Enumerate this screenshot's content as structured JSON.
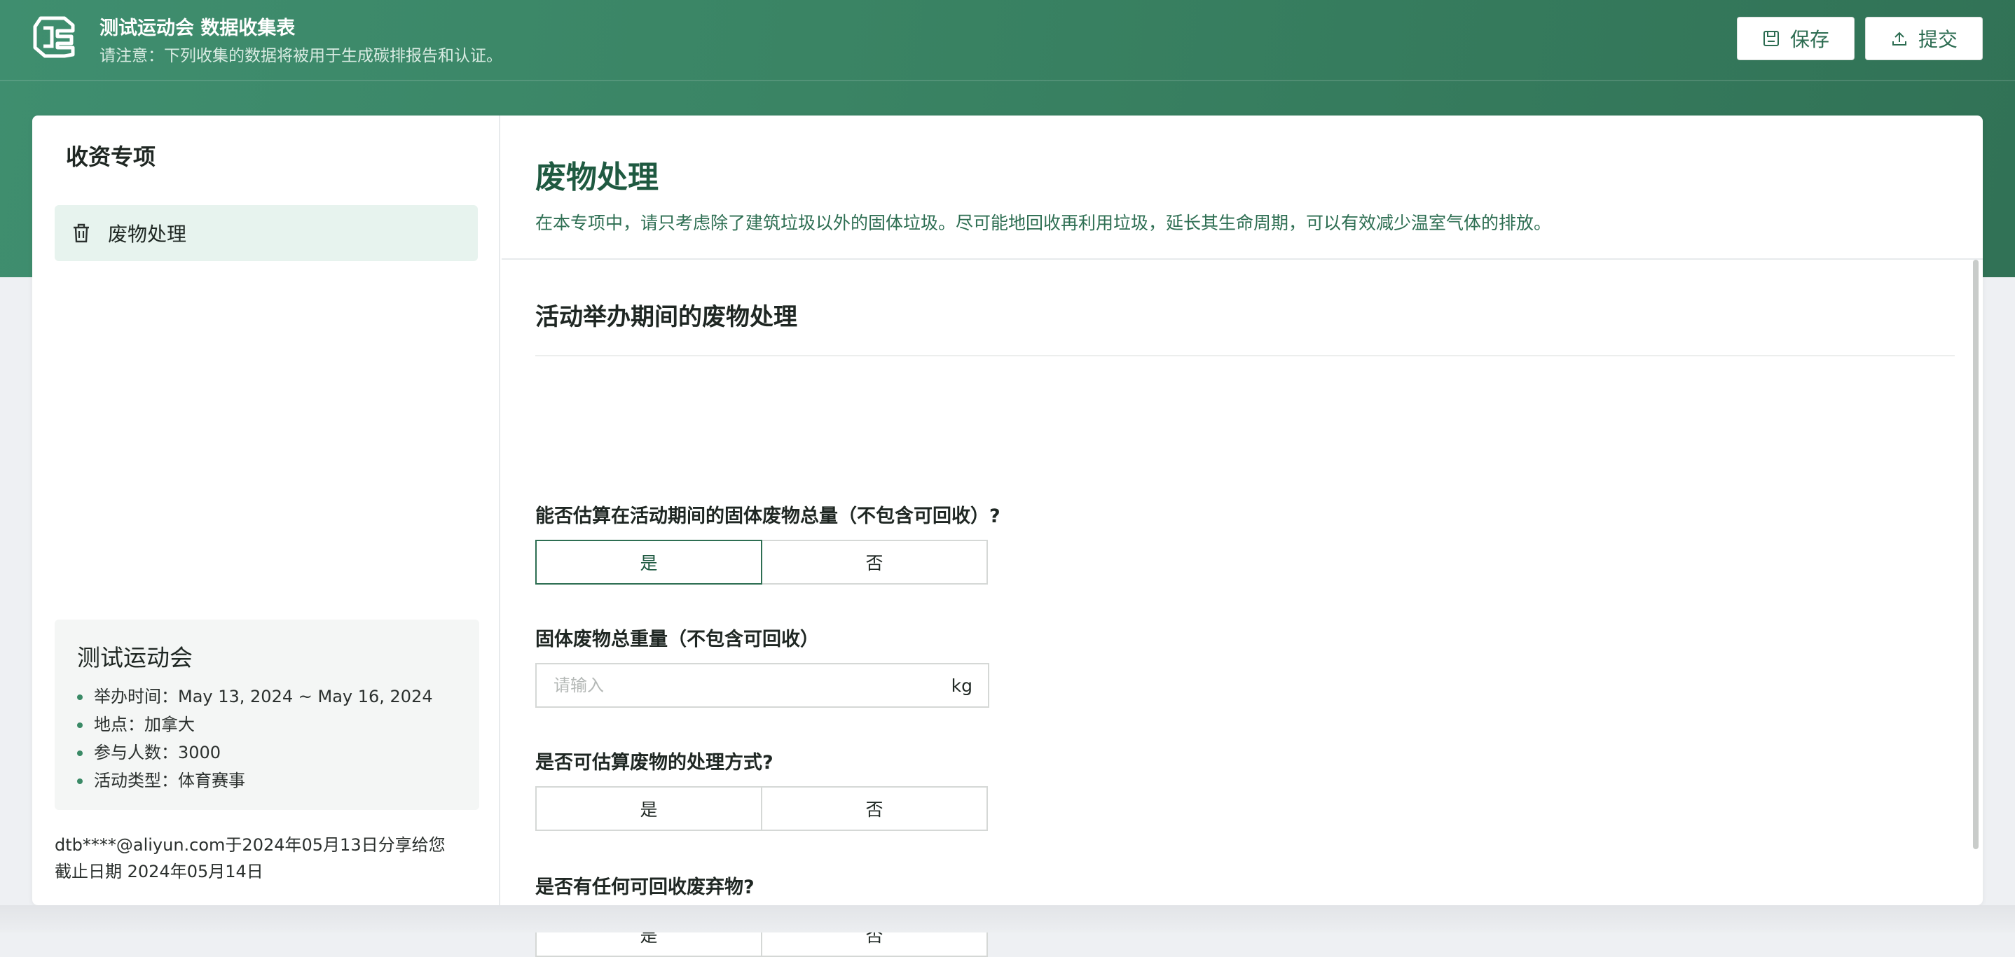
{
  "header": {
    "title": "测试运动会 数据收集表",
    "notice": "请注意：下列收集的数据将被用于生成碳排报告和认证。",
    "save_label": "保存",
    "submit_label": "提交",
    "logo_icon": "app-logo-icon"
  },
  "sidebar": {
    "title": "收资专项",
    "items": [
      {
        "label": "废物处理",
        "icon": "trash-icon",
        "active": true
      }
    ],
    "event": {
      "name": "测试运动会",
      "details": [
        "举办时间：May 13, 2024 ~ May 16, 2024",
        "地点：加拿大",
        "参与人数：3000",
        "活动类型：体育赛事"
      ]
    },
    "share_text": "dtb****@aliyun.com于2024年05月13日分享给您",
    "deadline_text": "截止日期 2024年05月14日"
  },
  "main": {
    "title": "废物处理",
    "description": "在本专项中，请只考虑除了建筑垃圾以外的固体垃圾。尽可能地回收再利用垃圾，延长其生命周期，可以有效减少温室气体的排放。",
    "section_title": "活动举办期间的废物处理",
    "questions": [
      {
        "label": "能否估算在活动期间的固体废物总量（不包含可回收）?",
        "yes": "是",
        "no": "否",
        "selected": "yes"
      },
      {
        "label": "固体废物总重量（不包含可回收）",
        "placeholder": "请输入",
        "unit": "kg",
        "value": ""
      },
      {
        "label": "是否可估算废物的处理方式?",
        "yes": "是",
        "no": "否",
        "selected": ""
      },
      {
        "label": "是否有任何可回收废弃物?",
        "yes": "是",
        "no": "否",
        "selected": ""
      }
    ]
  },
  "colors": {
    "brand": "#3a8464",
    "accent_text": "#1f5a41",
    "selected_border": "#2d6e52"
  }
}
